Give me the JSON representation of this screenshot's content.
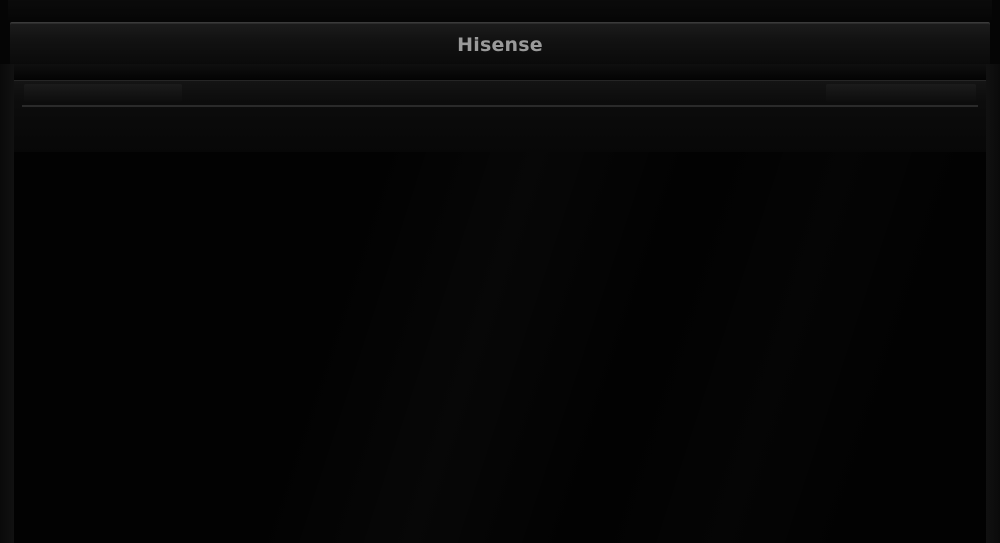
{
  "brand": {
    "logo_text": "Hisense"
  },
  "colors": {
    "body": "#050505",
    "panel": "#141414",
    "logo": "#9a9a9a"
  }
}
